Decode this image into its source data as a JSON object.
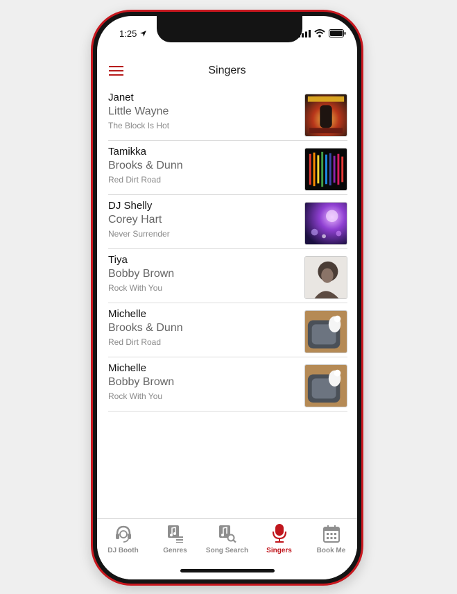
{
  "status": {
    "time": "1:25"
  },
  "header": {
    "title": "Singers"
  },
  "colors": {
    "accent": "#c0161d",
    "inactive": "#8e8e8e"
  },
  "singers": [
    {
      "singer": "Janet",
      "artist": "Little Wayne",
      "song": "The Block Is Hot"
    },
    {
      "singer": "Tamikka",
      "artist": "Brooks & Dunn",
      "song": "Red Dirt Road"
    },
    {
      "singer": "DJ Shelly",
      "artist": "Corey Hart",
      "song": "Never Surrender"
    },
    {
      "singer": "Tiya",
      "artist": "Bobby Brown",
      "song": "Rock With You"
    },
    {
      "singer": "Michelle",
      "artist": "Brooks & Dunn",
      "song": "Red Dirt Road"
    },
    {
      "singer": "Michelle",
      "artist": "Bobby Brown",
      "song": "Rock With You"
    }
  ],
  "tabs": [
    {
      "label": "DJ Booth",
      "icon": "headset-icon",
      "active": false
    },
    {
      "label": "Genres",
      "icon": "genres-icon",
      "active": false
    },
    {
      "label": "Song Search",
      "icon": "song-search-icon",
      "active": false
    },
    {
      "label": "Singers",
      "icon": "microphone-icon",
      "active": true
    },
    {
      "label": "Book Me",
      "icon": "calendar-icon",
      "active": false
    }
  ]
}
